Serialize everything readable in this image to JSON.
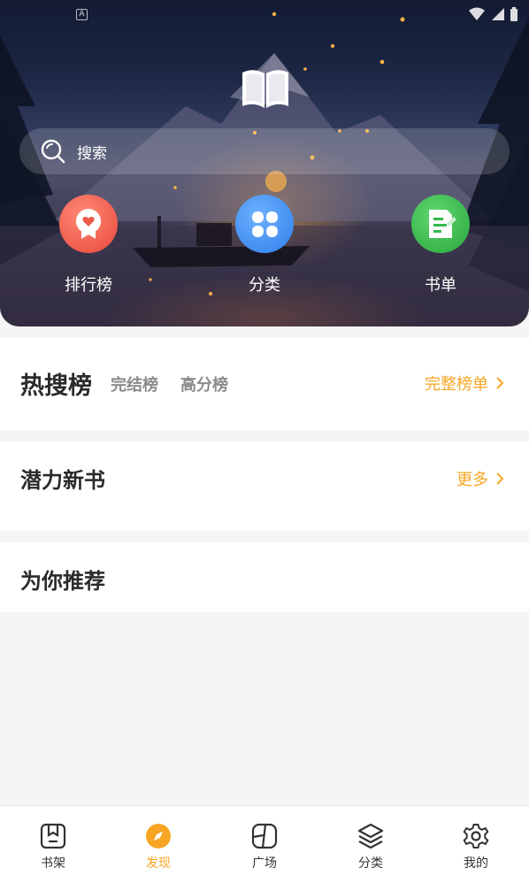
{
  "status_bar": {
    "time": ""
  },
  "search": {
    "placeholder": "搜索"
  },
  "quick_entries": [
    {
      "label": "排行榜",
      "icon": "ranking-icon",
      "color": "#ef5a4a"
    },
    {
      "label": "分类",
      "icon": "category-icon",
      "color": "#3b8df0"
    },
    {
      "label": "书单",
      "icon": "booklist-icon",
      "color": "#36b84a"
    }
  ],
  "hot_section": {
    "title": "热搜榜",
    "tabs": [
      "完结榜",
      "高分榜"
    ],
    "more_label": "完整榜单"
  },
  "potential_section": {
    "title": "潜力新书",
    "more_label": "更多"
  },
  "recommend_section": {
    "title": "为你推荐"
  },
  "bottom_nav": {
    "active_index": 1,
    "items": [
      {
        "label": "书架",
        "icon": "bookshelf-icon"
      },
      {
        "label": "发现",
        "icon": "compass-icon"
      },
      {
        "label": "广场",
        "icon": "square-icon"
      },
      {
        "label": "分类",
        "icon": "layers-icon"
      },
      {
        "label": "我的",
        "icon": "gear-icon"
      }
    ]
  },
  "colors": {
    "accent": "#f6a623",
    "background": "#f5f5f5"
  }
}
